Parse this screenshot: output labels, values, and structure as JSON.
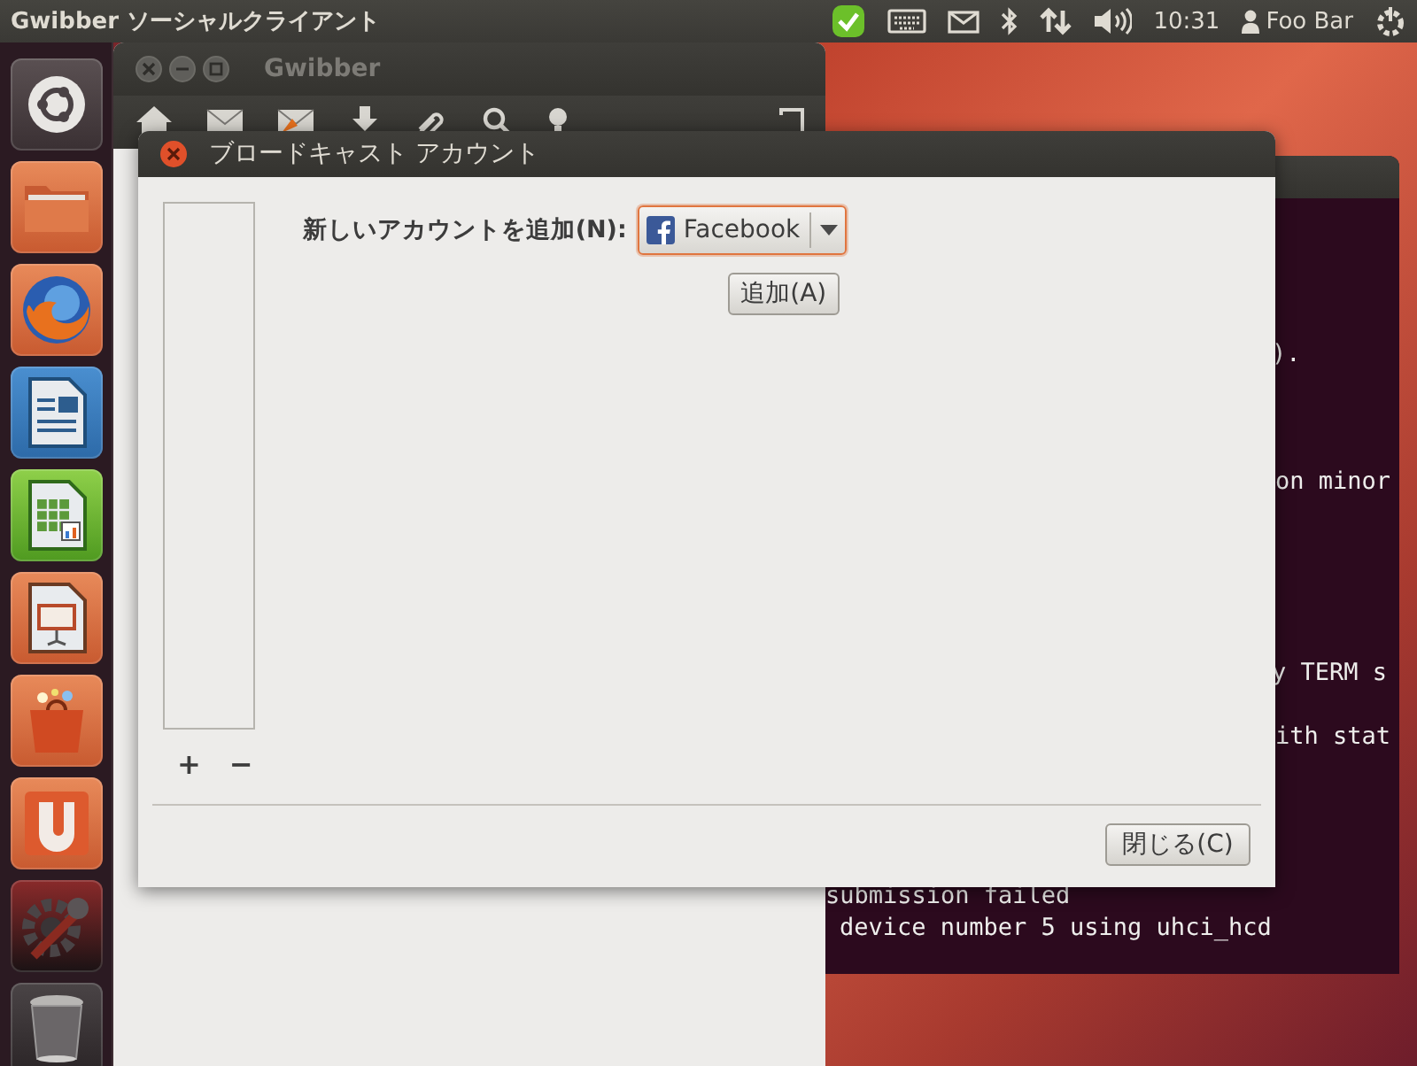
{
  "top_panel": {
    "app_title": "Gwibber ソーシャルクライアント",
    "clock": "10:31",
    "user": "Foo Bar"
  },
  "launcher": {
    "items": [
      {
        "kind": "dash"
      },
      {
        "kind": "files"
      },
      {
        "kind": "browser"
      },
      {
        "kind": "writer"
      },
      {
        "kind": "calc"
      },
      {
        "kind": "impress"
      },
      {
        "kind": "software"
      },
      {
        "kind": "ubuntu-one"
      },
      {
        "kind": "settings"
      },
      {
        "kind": "trash"
      }
    ]
  },
  "gwibber_window": {
    "title": "Gwibber"
  },
  "terminal": {
    "lines": [
      ").",
      "on minor",
      "y TERM s",
      "ith stat",
      "submission failed",
      "device number 5 using uhci_hcd"
    ]
  },
  "dialog": {
    "title": "ブロードキャスト アカウント",
    "add_label": "新しいアカウントを追加(N):",
    "service": {
      "value": "Facebook",
      "focused": true
    },
    "add_button": "追加(A)",
    "list_add": "+",
    "list_remove": "−",
    "close_button": "閉じる(C)"
  }
}
